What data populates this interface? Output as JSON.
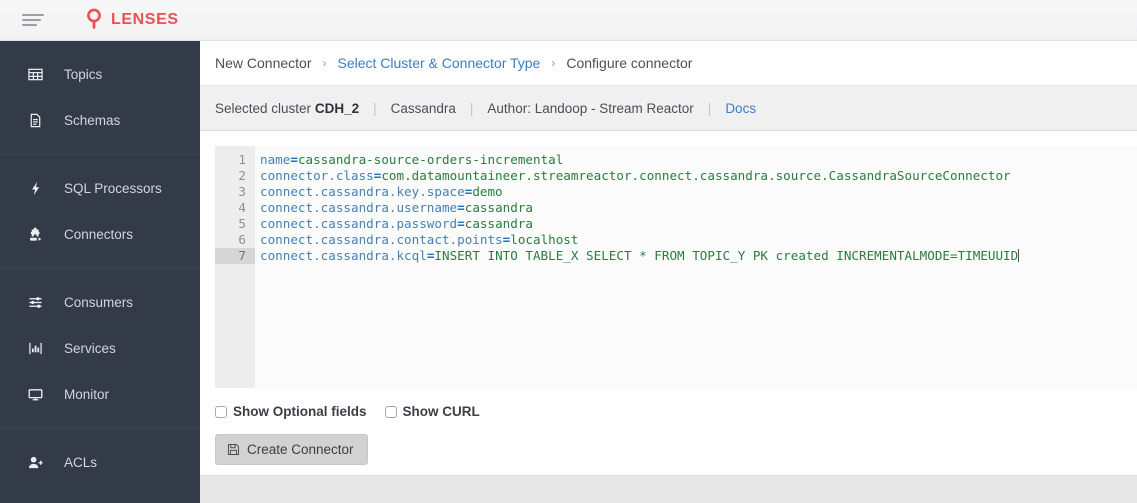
{
  "header": {
    "menu_icon": "hamburger-icon",
    "logo_icon": "lens-logo-icon",
    "brand": "LENSES",
    "brand_color": "#ef4f4f"
  },
  "sidebar": {
    "background_color": "#333b49",
    "groups": [
      {
        "items": [
          {
            "icon": "grid-icon",
            "label": "Topics"
          },
          {
            "icon": "document-icon",
            "label": "Schemas"
          }
        ]
      },
      {
        "items": [
          {
            "icon": "bolt-icon",
            "label": "SQL Processors"
          },
          {
            "icon": "puzzle-icon",
            "label": "Connectors"
          }
        ]
      },
      {
        "items": [
          {
            "icon": "sliders-icon",
            "label": "Consumers"
          },
          {
            "icon": "bar-chart-icon",
            "label": "Services"
          },
          {
            "icon": "monitor-icon",
            "label": "Monitor"
          }
        ]
      },
      {
        "items": [
          {
            "icon": "user-plus-icon",
            "label": "ACLs"
          }
        ]
      }
    ]
  },
  "breadcrumb": {
    "separator": "›",
    "items": [
      {
        "label": "New Connector",
        "link": false
      },
      {
        "label": "Select Cluster & Connector Type",
        "link": true
      },
      {
        "label": "Configure connector",
        "link": false
      }
    ]
  },
  "infobar": {
    "cluster_prefix": "Selected cluster",
    "cluster_name": "CDH_2",
    "connector_type": "Cassandra",
    "author": "Author: Landoop - Stream Reactor",
    "docs_label": "Docs",
    "separator": "|"
  },
  "editor": {
    "line_numbers": [
      "1",
      "2",
      "3",
      "4",
      "5",
      "6",
      "7"
    ],
    "active_line": 7,
    "colors": {
      "key": "#4a81b0",
      "equals": "#1a73c9",
      "value": "#2c7b3f",
      "gutter_bg": "#ededed",
      "active_gutter_bg": "#d6d6d6"
    },
    "lines": [
      {
        "key": "name",
        "eq": "=",
        "value": "cassandra-source-orders-incremental"
      },
      {
        "key": "connector.class",
        "eq": "=",
        "value": "com.datamountaineer.streamreactor.connect.cassandra.source.CassandraSourceConnector"
      },
      {
        "key": "connect.cassandra.key.space",
        "eq": "=",
        "value": "demo"
      },
      {
        "key": "connect.cassandra.username",
        "eq": "=",
        "value": "cassandra"
      },
      {
        "key": "connect.cassandra.password",
        "eq": "=",
        "value": "cassandra"
      },
      {
        "key": "connect.cassandra.contact.points",
        "eq": "=",
        "value": "localhost"
      },
      {
        "key": "connect.cassandra.kcql",
        "eq": "=",
        "value": "INSERT INTO TABLE_X SELECT * FROM TOPIC_Y PK created INCREMENTALMODE=TIMEUUID"
      }
    ]
  },
  "options": {
    "show_optional_fields": {
      "label": "Show Optional fields",
      "checked": false
    },
    "show_curl": {
      "label": "Show CURL",
      "checked": false
    }
  },
  "actions": {
    "create_connector": {
      "label": "Create Connector",
      "icon": "save-icon"
    }
  }
}
